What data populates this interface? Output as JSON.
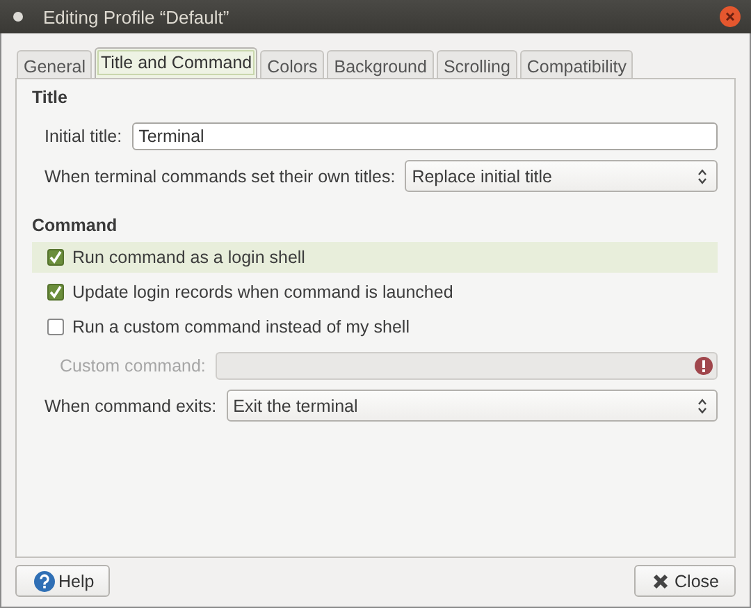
{
  "window": {
    "title": "Editing Profile “Default”"
  },
  "tabs": [
    {
      "label": "General",
      "selected": false
    },
    {
      "label": "Title and Command",
      "selected": true
    },
    {
      "label": "Colors",
      "selected": false
    },
    {
      "label": "Background",
      "selected": false
    },
    {
      "label": "Scrolling",
      "selected": false
    },
    {
      "label": "Compatibility",
      "selected": false
    }
  ],
  "title_section": {
    "heading": "Title",
    "initial_title": {
      "label": "Initial title:",
      "value": "Terminal"
    },
    "title_mode": {
      "label": "When terminal commands set their own titles:",
      "value": "Replace initial title"
    }
  },
  "command_section": {
    "heading": "Command",
    "options": [
      {
        "label": "Run command as a login shell",
        "checked": true,
        "highlighted": true
      },
      {
        "label": "Update login records when command is launched",
        "checked": true,
        "highlighted": false
      },
      {
        "label": "Run a custom command instead of my shell",
        "checked": false,
        "highlighted": false
      }
    ],
    "custom_command": {
      "label": "Custom command:",
      "disabled": true,
      "warning": true
    },
    "exit_action": {
      "label": "When command exits:",
      "value": "Exit the terminal"
    }
  },
  "buttons": [
    {
      "label": "Help",
      "kind": "help"
    },
    {
      "label": "Close",
      "kind": "close"
    }
  ]
}
